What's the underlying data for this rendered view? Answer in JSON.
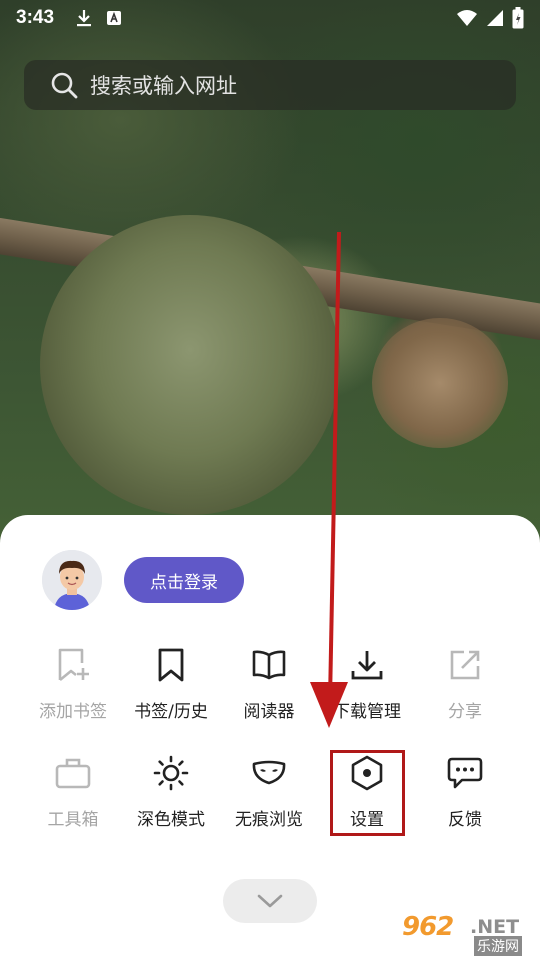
{
  "status_bar": {
    "time": "3:43",
    "icons": [
      "download-icon",
      "text-a-icon",
      "wifi-icon",
      "signal-icon",
      "battery-icon"
    ]
  },
  "search": {
    "placeholder": "搜索或输入网址"
  },
  "sheet": {
    "login_label": "点击登录",
    "row1": [
      {
        "label": "添加书签",
        "icon": "bookmark-add-icon",
        "disabled": true
      },
      {
        "label": "书签/历史",
        "icon": "bookmark-icon",
        "disabled": false
      },
      {
        "label": "阅读器",
        "icon": "book-open-icon",
        "disabled": false
      },
      {
        "label": "下载管理",
        "icon": "download-icon",
        "disabled": false
      },
      {
        "label": "分享",
        "icon": "share-icon",
        "disabled": true
      }
    ],
    "row2": [
      {
        "label": "工具箱",
        "icon": "toolbox-icon",
        "disabled": true
      },
      {
        "label": "深色模式",
        "icon": "sun-icon",
        "disabled": false
      },
      {
        "label": "无痕浏览",
        "icon": "mask-icon",
        "disabled": false
      },
      {
        "label": "设置",
        "icon": "settings-hexagon-icon",
        "disabled": false
      },
      {
        "label": "反馈",
        "icon": "chat-bubble-icon",
        "disabled": false
      }
    ]
  },
  "watermark": {
    "main": "962",
    "suffix": ".NET",
    "sub": "乐游网"
  },
  "colors": {
    "login_button": "#6058c8",
    "annotation": "#c21b1b",
    "disabled_text": "#a5a5a5"
  }
}
